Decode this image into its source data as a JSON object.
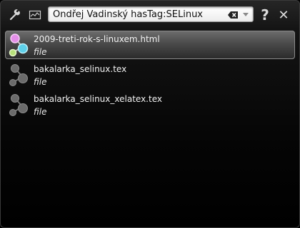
{
  "toolbar": {
    "settings_icon": "wrench-icon",
    "activity_icon": "chart-icon",
    "help_label": "?",
    "close_label": "✕"
  },
  "search": {
    "value": "Ondřej Vadinský hasTag:SELinux"
  },
  "results": [
    {
      "name": "2009-treti-rok-s-linuxem.html",
      "type": "file",
      "selected": true
    },
    {
      "name": "bakalarka_selinux.tex",
      "type": "file",
      "selected": false
    },
    {
      "name": "bakalarka_selinux_xelatex.tex",
      "type": "file",
      "selected": false
    }
  ]
}
